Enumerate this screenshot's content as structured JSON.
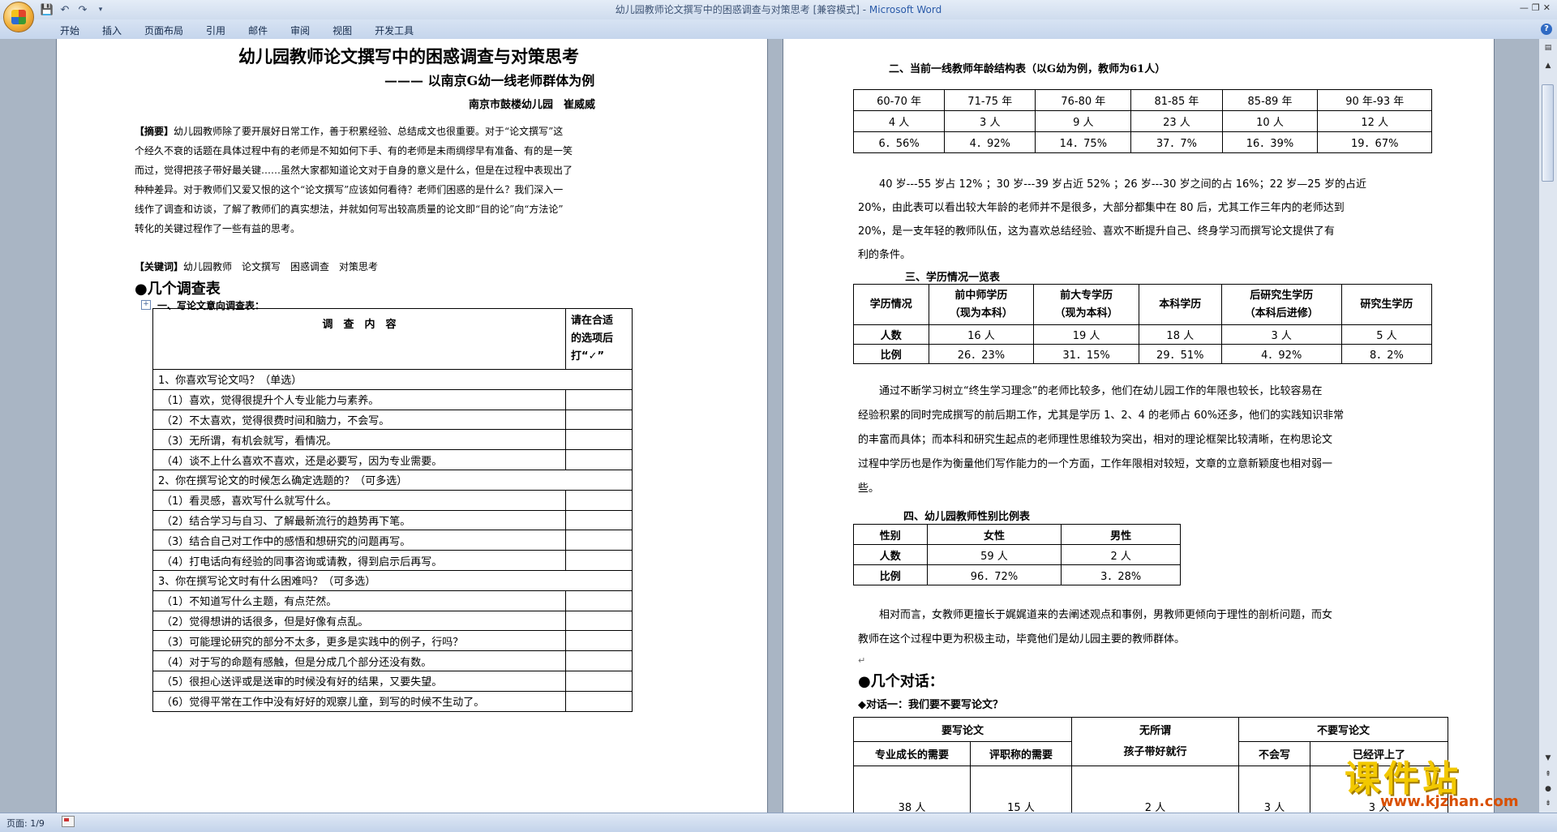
{
  "window": {
    "title_doc": "幼儿园教师论文撰写中的困惑调查与对策思考 [兼容模式] - ",
    "title_app": "Microsoft Word"
  },
  "ribbon": {
    "tabs": [
      "开始",
      "插入",
      "页面布局",
      "引用",
      "邮件",
      "审阅",
      "视图",
      "开发工具"
    ]
  },
  "status": {
    "page": "页面: 1/9"
  },
  "watermark": {
    "text": "课件站",
    "url": "www.kjzhan.com"
  },
  "left_page": {
    "title": "幼儿园教师论文撰写中的困惑调查与对策思考",
    "subtitle": "——— 以南京G幼一线老师群体为例",
    "author": "南京市鼓楼幼儿园　崔威威",
    "abstract_label": "【摘要】",
    "abstract_lines": [
      "幼儿园教师除了要开展好日常工作，善于积累经验、总结成文也很重要。对于“论文撰写”这",
      "个经久不衰的话题在具体过程中有的老师是不知如何下手、有的老师是未雨绸缪早有准备、有的是一笑",
      "而过，觉得把孩子带好最关键……虽然大家都知道论文对于自身的意义是什么，但是在过程中表现出了",
      "种种差异。对于教师们又爱又恨的这个“论文撰写”应该如何看待？老师们困惑的是什么？我们深入一",
      "线作了调查和访谈，了解了教师们的真实想法，并就如何写出较高质量的论文即“目的论”向“方法论”",
      "转化的关键过程作了一些有益的思考。"
    ],
    "keywords_label": "【关键词】",
    "keywords": "幼儿园教师　论文撰写　困惑调查　对策思考",
    "heading1": "●几个调查表",
    "sub1": "一、写论文意向调查表：",
    "survey_header_left": "调　查　内　容",
    "survey_header_right": [
      "请在合适",
      "的选项后",
      "打“✓”"
    ],
    "survey_rows": [
      {
        "text": "1、你喜欢写论文吗？（单选）",
        "q": true
      },
      {
        "text": "（1）喜欢，觉得很提升个人专业能力与素养。",
        "q": false
      },
      {
        "text": "（2）不太喜欢，觉得很费时间和脑力，不会写。",
        "q": false
      },
      {
        "text": "（3）无所谓，有机会就写，看情况。",
        "q": false
      },
      {
        "text": "（4）谈不上什么喜欢不喜欢，还是必要写，因为专业需要。",
        "q": false
      },
      {
        "text": "2、你在撰写论文的时候怎么确定选题的？（可多选）",
        "q": true
      },
      {
        "text": "（1）看灵感，喜欢写什么就写什么。",
        "q": false
      },
      {
        "text": "（2）结合学习与自习、了解最新流行的趋势再下笔。",
        "q": false
      },
      {
        "text": "（3）结合自己对工作中的感悟和想研究的问题再写。",
        "q": false
      },
      {
        "text": "（4）打电话向有经验的同事咨询或请教，得到启示后再写。",
        "q": false
      },
      {
        "text": "3、你在撰写论文时有什么困难吗？（可多选）",
        "q": true
      },
      {
        "text": "（1）不知道写什么主题，有点茫然。",
        "q": false
      },
      {
        "text": "（2）觉得想讲的话很多，但是好像有点乱。",
        "q": false
      },
      {
        "text": "（3）可能理论研究的部分不太多，更多是实践中的例子，行吗？",
        "q": false
      },
      {
        "text": "（4）对于写的命题有感触，但是分成几个部分还没有数。",
        "q": false
      },
      {
        "text": "（5）很担心送评或是送审的时候没有好的结果，又要失望。",
        "q": false
      },
      {
        "text": "（6）觉得平常在工作中没有好好的观察儿童，到写的时候不生动了。",
        "q": false
      }
    ]
  },
  "right_page": {
    "t2_caption": "二、当前一线教师年龄结构表（以G幼为例，教师为61人）",
    "age_table": [
      [
        "60-70 年",
        "71-75 年",
        "76-80 年",
        "81-85 年",
        "85-89 年",
        "90 年-93 年"
      ],
      [
        "4 人",
        "3 人",
        "9 人",
        "23 人",
        "10 人",
        "12 人"
      ],
      [
        "6．56%",
        "4．92%",
        "14．75%",
        "37．7%",
        "16．39%",
        "19．67%"
      ]
    ],
    "para1": [
      "40 岁---55 岁占 12% ；30 岁---39 岁占近 52% ；26 岁---30 岁之间的占 16%；22 岁—25 岁的占近",
      "20%，由此表可以看出较大年龄的老师并不是很多，大部分都集中在 80 后，尤其工作三年内的老师达到",
      "20%，是一支年轻的教师队伍，这为喜欢总结经验、喜欢不断提升自己、终身学习而撰写论文提供了有",
      "利的条件。"
    ],
    "t3_caption": "三、学历情况一览表",
    "edu_header": [
      "学历情况",
      "前中师学历\n（现为本科）",
      "前大专学历\n（现为本科）",
      "本科学历",
      "后研究生学历\n（本科后进修）",
      "研究生学历"
    ],
    "edu_count": [
      "人数",
      "16 人",
      "19 人",
      "18 人",
      "3 人",
      "5 人"
    ],
    "edu_ratio": [
      "比例",
      "26．23%",
      "31．15%",
      "29．51%",
      "4．92%",
      "8．2%"
    ],
    "para2": [
      "通过不断学习树立“终生学习理念”的老师比较多，他们在幼儿园工作的年限也较长，比较容易在",
      "经验积累的同时完成撰写的前后期工作，尤其是学历 1、2、4 的老师占 60%还多，他们的实践知识非常",
      "的丰富而具体；而本科和研究生起点的老师理性思维较为突出，相对的理论框架比较清晰，在构思论文",
      "过程中学历也是作为衡量他们写作能力的一个方面，工作年限相对较短，文章的立意新颖度也相对弱一",
      "些。"
    ],
    "t4_caption": "四、幼儿园教师性别比例表",
    "gender_table": [
      [
        "性别",
        "女性",
        "男性"
      ],
      [
        "人数",
        "59 人",
        "2 人"
      ],
      [
        "比例",
        "96．72%",
        "3．28%"
      ]
    ],
    "para3": [
      "相对而言，女教师更擅长于娓娓道来的去阐述观点和事例，男教师更倾向于理性的剖析问题，而女",
      "教师在这个过程中更为积极主动，毕竟他们是幼儿园主要的教师群体。"
    ],
    "heading2": "●几个对话：",
    "dialog1": "◆对话一：我们要不要写论文？",
    "dlg_top": [
      "要写论文",
      "无所谓",
      "不要写论文"
    ],
    "dlg_sub": [
      "专业成长的需要",
      "评职称的需要",
      "孩子带好就行",
      "不会写",
      "已经评上了"
    ],
    "dlg_count": [
      "38 人",
      "15 人",
      "2 人",
      "3 人",
      "3 人"
    ]
  }
}
